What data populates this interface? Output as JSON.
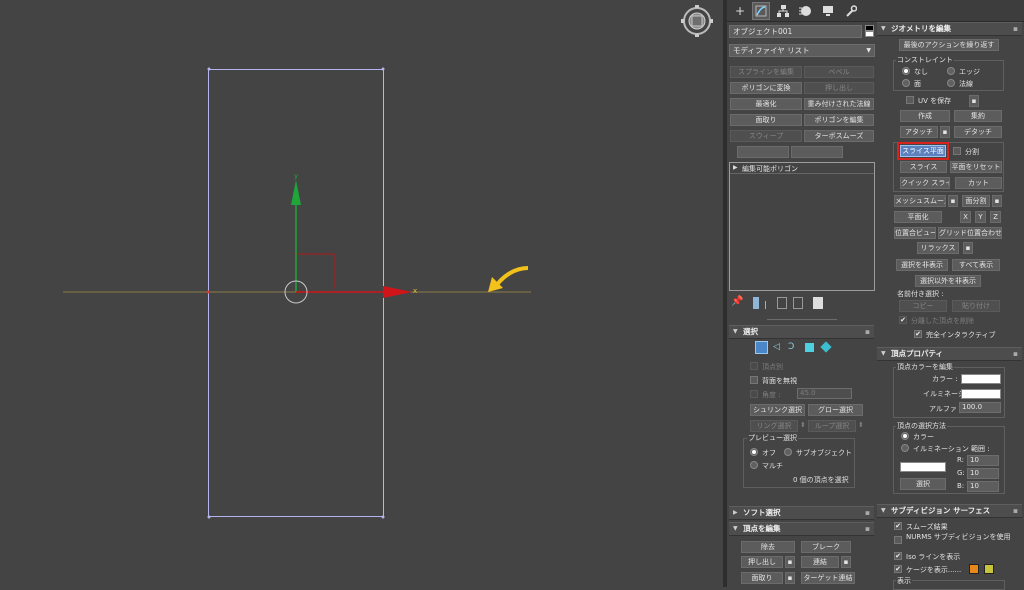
{
  "viewport": {
    "gizmo_label": "y",
    "axis_x_label": "x",
    "colors": {
      "grid": "#8a7d4a",
      "frame": "#b4b4ee",
      "y_axis": "#1fa53a",
      "x_axis": "#d0141a",
      "arrow": "#f3c21a"
    }
  },
  "toolbar": {
    "icons": [
      "create-icon",
      "modify-icon",
      "hierarchy-icon",
      "motion-icon",
      "display-icon",
      "utilities-icon"
    ]
  },
  "left": {
    "object_name": "オブジェクト001",
    "modifier_list": "モディファイヤ リスト",
    "buttons": {
      "spline_edit": "スプラインを編集",
      "bevel": "ベベル",
      "convert_poly": "ポリゴンに変換",
      "extrude": "押し出し",
      "optimize": "最適化",
      "weighted_normals": "重み付けされた法線",
      "chamfer": "面取り",
      "edit_poly": "ポリゴンを編集",
      "sweep": "スウィープ",
      "turbosmooth": "ターボスムーズ"
    },
    "stack_item": "編集可能ポリゴン",
    "selection": {
      "title": "選択",
      "by_vertex": "頂点別",
      "ignore_backface": "背面を無視",
      "angle_label": "角度 :",
      "angle_value": "45.0",
      "shrink": "シュリンク選択",
      "grow": "グロー選択",
      "ring": "リング選択",
      "loop": "ループ選択",
      "preview_title": "プレビュー選択",
      "off": "オフ",
      "subobject": "サブオブジェクト",
      "multi": "マルチ",
      "status": "0 個の頂点を選択"
    },
    "soft_selection": {
      "title": "ソフト選択"
    },
    "edit_vertices": {
      "title": "頂点を編集",
      "remove": "除去",
      "break": "ブレーク",
      "extrude": "押し出し",
      "weld": "連結",
      "chamfer": "面取り",
      "target_weld": "ターゲット連結"
    }
  },
  "right": {
    "edit_geometry": {
      "title": "ジオメトリを編集",
      "repeat_last": "最後のアクションを繰り返す",
      "constraints_title": "コンストレイント",
      "none": "なし",
      "edge": "エッジ",
      "face": "面",
      "normal": "法線",
      "preserve_uvs": "UV を保存",
      "create": "作成",
      "collapse": "集約",
      "attach": "アタッチ",
      "detach": "デタッチ",
      "slice_plane": "スライス平面",
      "split": "分割",
      "slice": "スライス",
      "reset_plane": "平面をリセット",
      "quickslice": "クイック スライス",
      "cut": "カット",
      "meshsmooth": "メッシュスムーズ",
      "tessellate": "面分割",
      "make_planar": "平面化",
      "x": "X",
      "y": "Y",
      "z": "Z",
      "view_align": "位置合ビュー",
      "grid_align": "グリッド位置合わせ",
      "relax": "リラックス",
      "hide_selected": "選択を非表示",
      "unhide_all": "すべて表示",
      "hide_unselected": "選択以外を非表示",
      "named_selections": "名前付き選択 :",
      "copy": "コピー",
      "paste": "貼り付け",
      "delete_isolated": "分離した頂点を削除",
      "full_interactivity": "完全インタラクティブ"
    },
    "vertex_properties": {
      "title": "頂点プロパティ",
      "edit_colors_title": "頂点カラーを編集",
      "color_label": "カラー :",
      "illum_label": "イルミネーション:",
      "alpha_label": "アルファ :",
      "alpha_value": "100.0",
      "select_by_title": "頂点の選択方法",
      "color_radio": "カラー",
      "illum_radio": "イルミネーション",
      "range_label": "範囲 :",
      "r_label": "R:",
      "g_label": "G:",
      "b_label": "B:",
      "r_value": "10",
      "g_value": "10",
      "b_value": "10",
      "select_button": "選択"
    },
    "subdivision": {
      "title": "サブディビジョン サーフェス",
      "smooth_result": "スムーズ結果",
      "nurms": "NURMS サブディビジョンを使用",
      "isolines": "Iso ラインを表示",
      "show_cage": "ケージを表示......",
      "display": "表示",
      "cage_color_1": "#e8871a",
      "cage_color_2": "#c6c43a"
    }
  }
}
